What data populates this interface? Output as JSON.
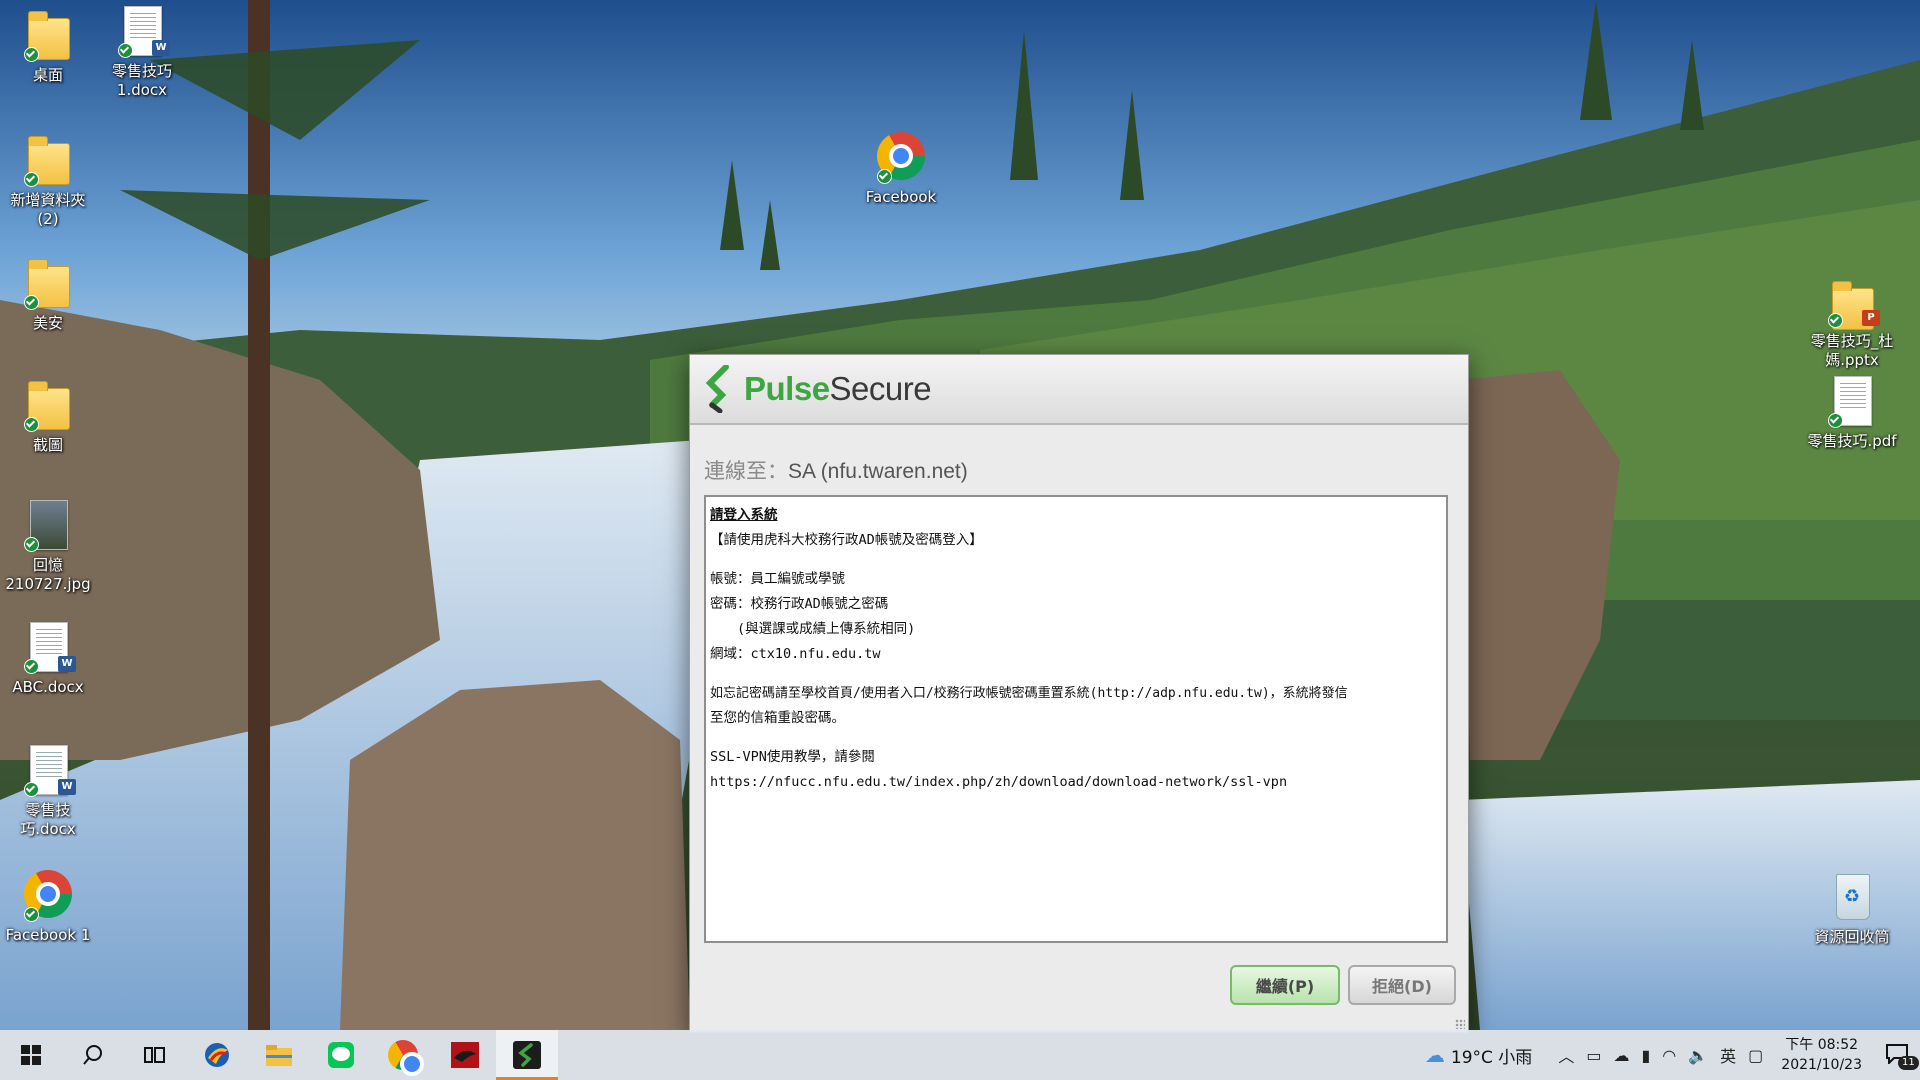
{
  "desktop": {
    "icons_left": [
      {
        "label": "桌面",
        "kind": "folder-doc"
      },
      {
        "label": "新增資料夾 (2)",
        "kind": "folder"
      },
      {
        "label": "美安",
        "kind": "folder"
      },
      {
        "label": "截圖",
        "kind": "folder-doc"
      },
      {
        "label": "回憶 210727.jpg",
        "kind": "photo"
      },
      {
        "label": "ABC.docx",
        "kind": "word"
      },
      {
        "label": "零售技巧.docx",
        "kind": "word"
      },
      {
        "label": "Facebook 1",
        "kind": "chrome"
      }
    ],
    "icon_doc_top": {
      "label": "零售技巧 1.docx",
      "kind": "word"
    },
    "icon_center": {
      "label": "Facebook",
      "kind": "chrome"
    },
    "icons_right": [
      {
        "label": "零售技巧_杜媽.pptx",
        "kind": "ppt"
      },
      {
        "label": "零售技巧.pdf",
        "kind": "pdf"
      },
      {
        "label": "資源回收筒",
        "kind": "recycle"
      }
    ]
  },
  "dialog": {
    "logo_part1": "Pulse",
    "logo_part2": "Secure",
    "connect_prefix": "連線至：",
    "connect_target": "SA (nfu.twaren.net)",
    "message_title": "請登入系統",
    "message_lines": [
      "【請使用虎科大校務行政AD帳號及密碼登入】",
      "",
      "帳號：員工編號或學號",
      "密碼：校務行政AD帳號之密碼",
      "　　(與選課或成績上傳系統相同)",
      "網域：ctx10.nfu.edu.tw",
      "",
      "如忘記密碼請至學校首頁/使用者入口/校務行政帳號密碼重置系統(http://adp.nfu.edu.tw)，系統將發信",
      "至您的信箱重設密碼。",
      "",
      "SSL-VPN使用教學，請參閱",
      "https://nfucc.nfu.edu.tw/index.php/zh/download/download-network/ssl-vpn"
    ],
    "continue_label": "繼續(P)",
    "decline_label": "拒絕(D)",
    "colors": {
      "brand_green": "#3da640",
      "continue_bg": "#b8e3ac"
    }
  },
  "taskbar": {
    "apps": [
      "windows-start",
      "search",
      "task-view",
      "vpn-app",
      "file-explorer",
      "line",
      "chrome",
      "red-app",
      "pulse-secure"
    ],
    "active_app": "pulse-secure",
    "weather": "19°C 小雨",
    "ime": "英",
    "time": "下午 08:52",
    "date": "2021/10/23",
    "notifications": "11"
  }
}
